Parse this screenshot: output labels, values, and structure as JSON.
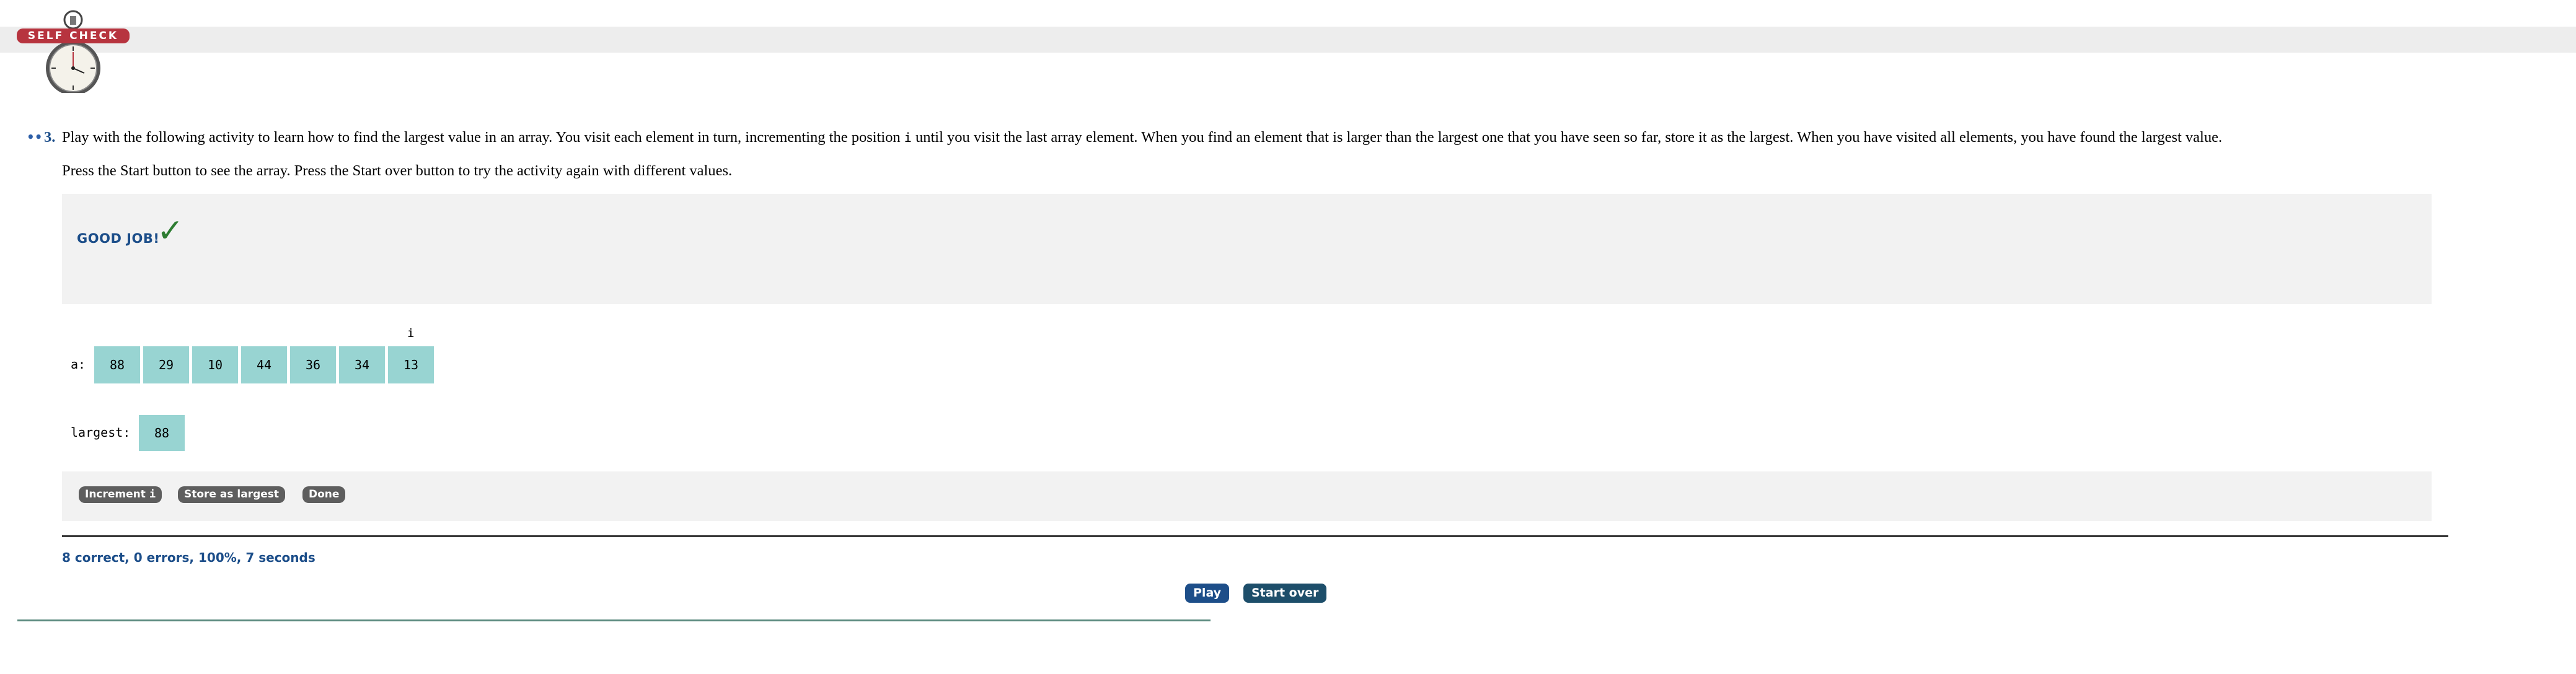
{
  "self_check": {
    "badge_label": "SELF CHECK",
    "icon": "stopwatch-icon"
  },
  "question": {
    "dots": "••",
    "number": "3.",
    "text_before_code": "Play with the following activity to learn how to find the largest value in an array. You visit each element in turn, incrementing the position ",
    "code_var": "i",
    "text_after_code": " until you visit the last array element. When you find an element that is larger than the largest one that you have seen so far, store it as the largest. When you have visited all elements, you have found the largest value.",
    "line2": "Press the Start button to see the array. Press the Start over button to try the activity again with different values."
  },
  "feedback": {
    "message": "GOOD JOB!",
    "icon": "checkmark-icon",
    "checkmark_glyph": "✓",
    "color": "#2e7d32"
  },
  "array": {
    "label": "a:",
    "values": [
      "88",
      "29",
      "10",
      "44",
      "36",
      "34",
      "13"
    ],
    "index_label": "i",
    "index_position": 6
  },
  "largest": {
    "label": "largest:",
    "value": "88"
  },
  "actions": {
    "increment_label": "Increment",
    "increment_code": "i",
    "store_label": "Store as largest",
    "done_label": "Done"
  },
  "status": {
    "text": "8 correct, 0 errors, 100%, 7 seconds"
  },
  "controls": {
    "play_label": "Play",
    "start_over_label": "Start over"
  },
  "colors": {
    "accent_blue": "#1b4d89",
    "cell_teal": "#98d4d2",
    "badge_red": "#b7343f"
  }
}
